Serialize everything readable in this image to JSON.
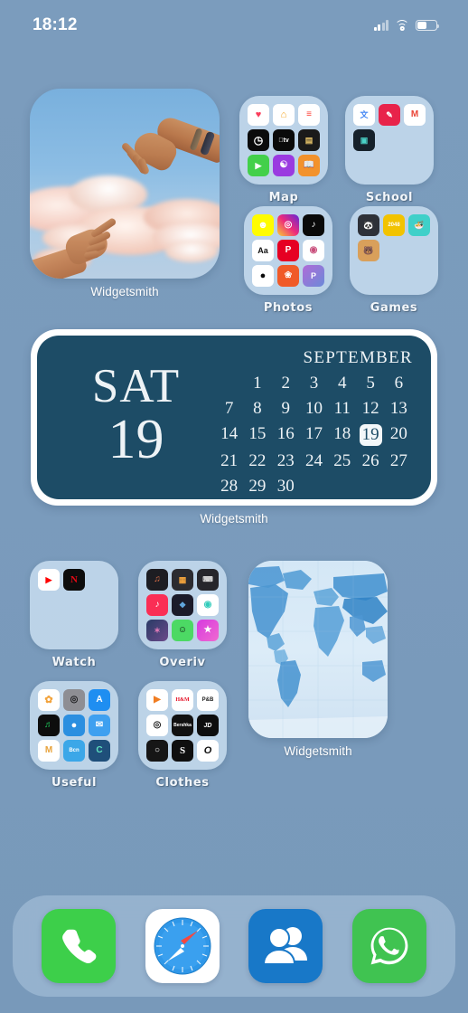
{
  "status_bar": {
    "time": "18:12",
    "signal_icon": "cellular-bars-icon",
    "wifi_icon": "wifi-icon",
    "battery_icon": "battery-icon",
    "battery_level_percent": 45
  },
  "wallpaper": {
    "background_color": "#799bbd"
  },
  "home_screen": {
    "rows": [
      {
        "row_index": 1,
        "items": [
          {
            "type": "widget",
            "name": "photo-widget",
            "label": "Widgetsmith",
            "size": "medium-square",
            "description": "two hands reaching toward each other over pink clouds in a blue sky"
          },
          {
            "type": "folder",
            "name": "folder-map",
            "label": "Map",
            "apps": [
              {
                "name": "health",
                "glyph": "♥",
                "bg": "#ffffff",
                "fg": "#fa3c5a"
              },
              {
                "name": "home",
                "glyph": "⌂",
                "bg": "#ffffff",
                "fg": "#f5a623"
              },
              {
                "name": "reminders",
                "glyph": "≡",
                "bg": "#ffffff",
                "fg": "#ff3b30"
              },
              {
                "name": "clock",
                "glyph": "◴",
                "bg": "#0b0b0b",
                "fg": "#ffffff"
              },
              {
                "name": "apple-tv",
                "glyph": "tv",
                "bg": "#0a0a0a",
                "fg": "#ffffff"
              },
              {
                "name": "wallet",
                "glyph": "▤",
                "bg": "#1a1a1a",
                "fg": "#e8c56a"
              },
              {
                "name": "facetime",
                "glyph": "▶",
                "bg": "#43d04a",
                "fg": "#ffffff"
              },
              {
                "name": "podcasts",
                "glyph": "✿",
                "bg": "#9a3ae0",
                "fg": "#ffffff"
              },
              {
                "name": "books",
                "glyph": "□",
                "bg": "#f2922c",
                "fg": "#ffffff"
              }
            ]
          },
          {
            "type": "folder",
            "name": "folder-school",
            "label": "School",
            "apps": [
              {
                "name": "google-translate",
                "glyph": "文",
                "bg": "#ffffff",
                "fg": "#4285f4"
              },
              {
                "name": "classroom",
                "glyph": "✎",
                "bg": "#e8234a",
                "fg": "#ffffff"
              },
              {
                "name": "gmail",
                "glyph": "M",
                "bg": "#ffffff",
                "fg": "#ea4335"
              },
              {
                "name": "teams",
                "glyph": "▣",
                "bg": "#16212b",
                "fg": "#4ad3c8"
              }
            ]
          }
        ]
      },
      {
        "row_index": 2,
        "items": [
          {
            "type": "folder",
            "name": "folder-photos",
            "label": "Photos",
            "apps": [
              {
                "name": "snapchat",
                "glyph": "●",
                "bg": "#fffc00",
                "fg": "#ffffff"
              },
              {
                "name": "instagram",
                "glyph": "◎",
                "bg": "#c13584",
                "fg": "#ffffff"
              },
              {
                "name": "tiktok",
                "glyph": "♪",
                "bg": "#0a0a0a",
                "fg": "#ffffff"
              },
              {
                "name": "fonts-app",
                "glyph": "Aa",
                "bg": "#ffffff",
                "fg": "#111111"
              },
              {
                "name": "pinterest",
                "glyph": "P",
                "bg": "#e60023",
                "fg": "#ffffff"
              },
              {
                "name": "vsco",
                "glyph": "◉",
                "bg": "#ffffff",
                "fg": "#c94f7c"
              },
              {
                "name": "lightroom",
                "glyph": "●",
                "bg": "#ffffff",
                "fg": "#0a0a0a"
              },
              {
                "name": "picsart",
                "glyph": "❀",
                "bg": "#f05a28",
                "fg": "#ffffff"
              },
              {
                "name": "prequel",
                "glyph": "P",
                "bg": "#b06bd8",
                "fg": "#ffffff"
              }
            ]
          },
          {
            "type": "folder",
            "name": "folder-games",
            "label": "Games",
            "apps": [
              {
                "name": "panda-game",
                "glyph": "●",
                "bg": "#2e3138",
                "fg": "#ffffff"
              },
              {
                "name": "2048-game",
                "glyph": "2048",
                "bg": "#f2c300",
                "fg": "#ffffff"
              },
              {
                "name": "cooking-game",
                "glyph": "●",
                "bg": "#3fd0c9",
                "fg": "#ffffff"
              },
              {
                "name": "bear-game",
                "glyph": "●",
                "bg": "#d9a05b",
                "fg": "#ffffff"
              }
            ]
          }
        ]
      },
      {
        "row_index": 3,
        "items": [
          {
            "type": "widget",
            "name": "calendar-widget",
            "label": "Widgetsmith",
            "size": "large-wide"
          }
        ]
      },
      {
        "row_index": 4,
        "items": [
          {
            "type": "folder",
            "name": "folder-watch",
            "label": "Watch",
            "apps": [
              {
                "name": "youtube",
                "glyph": "▶",
                "bg": "#ffffff",
                "fg": "#ff0000"
              },
              {
                "name": "netflix",
                "glyph": "N",
                "bg": "#0d0d0d",
                "fg": "#e50914"
              }
            ]
          },
          {
            "type": "folder",
            "name": "folder-overiv",
            "label": "Overiv",
            "apps": [
              {
                "name": "garageband",
                "glyph": "♫",
                "bg": "#1d1d22",
                "fg": "#e8734a"
              },
              {
                "name": "calculator",
                "glyph": "▦",
                "bg": "#2b2b30",
                "fg": "#f2a33c"
              },
              {
                "name": "keyboard-app",
                "glyph": "⌨",
                "bg": "#26262b",
                "fg": "#d8d8d8"
              },
              {
                "name": "apple-music",
                "glyph": "♪",
                "bg": "#fa2e55",
                "fg": "#ffffff"
              },
              {
                "name": "shortcuts",
                "glyph": "❖",
                "bg": "#1b1b2a",
                "fg": "#62a8e0"
              },
              {
                "name": "waze",
                "glyph": "◉",
                "bg": "#ffffff",
                "fg": "#33ccbb"
              },
              {
                "name": "spark",
                "glyph": "✦",
                "bg": "#2a3b66",
                "fg": "#e07ab8"
              },
              {
                "name": "messenger-green",
                "glyph": "☺",
                "bg": "#4cd964",
                "fg": "#0a0a0a"
              },
              {
                "name": "imovie",
                "glyph": "★",
                "bg": "#d63ae0",
                "fg": "#ffffff"
              }
            ]
          },
          {
            "type": "widget",
            "name": "world-map-widget",
            "label": "Widgetsmith",
            "size": "tall",
            "description": "blue political world map"
          }
        ]
      },
      {
        "row_index": 5,
        "items": [
          {
            "type": "folder",
            "name": "folder-useful",
            "label": "Useful",
            "apps": [
              {
                "name": "photos",
                "glyph": "✿",
                "bg": "#ffffff",
                "fg": "#f2a33c"
              },
              {
                "name": "camera",
                "glyph": "◎",
                "bg": "#8e8e93",
                "fg": "#1c1c1e"
              },
              {
                "name": "app-store",
                "glyph": "A",
                "bg": "#1f8ef1",
                "fg": "#ffffff"
              },
              {
                "name": "spotify",
                "glyph": "♬",
                "bg": "#0d0d0d",
                "fg": "#1db954"
              },
              {
                "name": "safari-alt",
                "glyph": "●",
                "bg": "#2b8fe0",
                "fg": "#ffffff"
              },
              {
                "name": "mail",
                "glyph": "✉",
                "bg": "#3ea0f0",
                "fg": "#ffffff"
              },
              {
                "name": "mcdonalds",
                "glyph": "M",
                "bg": "#ffffff",
                "fg": "#e8a33c"
              },
              {
                "name": "bcn-transit",
                "glyph": "Bcn",
                "bg": "#3ba7e8",
                "fg": "#ffffff"
              },
              {
                "name": "calendar-app",
                "glyph": "C",
                "bg": "#1f4f7a",
                "fg": "#5fe0c0"
              }
            ]
          },
          {
            "type": "folder",
            "name": "folder-clothes",
            "label": "Clothes",
            "apps": [
              {
                "name": "shein",
                "glyph": "▶",
                "bg": "#ffffff",
                "fg": "#f07d22"
              },
              {
                "name": "hm",
                "glyph": "H&M",
                "bg": "#ffffff",
                "fg": "#e50f24"
              },
              {
                "name": "pull-and-bear",
                "glyph": "P&B",
                "bg": "#ffffff",
                "fg": "#1a1a1a"
              },
              {
                "name": "zara",
                "glyph": "◎",
                "bg": "#ffffff",
                "fg": "#1a1a1a"
              },
              {
                "name": "bershka",
                "glyph": "B",
                "bg": "#111111",
                "fg": "#ffffff"
              },
              {
                "name": "jd-sports",
                "glyph": "JD",
                "bg": "#0d0d0d",
                "fg": "#ffffff"
              },
              {
                "name": "stradivarius",
                "glyph": "○",
                "bg": "#161616",
                "fg": "#ffffff"
              },
              {
                "name": "sfera",
                "glyph": "S",
                "bg": "#0f0f0f",
                "fg": "#ffffff"
              },
              {
                "name": "oysho",
                "glyph": "O",
                "bg": "#ffffff",
                "fg": "#111111"
              }
            ]
          },
          {
            "type": "widget-continued",
            "name": "world-map-widget-label",
            "label": "Widgetsmith"
          }
        ]
      }
    ]
  },
  "calendar_widget": {
    "weekday": "SAT",
    "day": "19",
    "month": "SEPTEMBER",
    "highlight_day": 19,
    "background_color": "#1d4c66",
    "border_color": "#ffffff",
    "text_color": "#eef3f6",
    "days": [
      "",
      "1",
      "2",
      "3",
      "4",
      "5",
      "6",
      "7",
      "8",
      "9",
      "10",
      "11",
      "12",
      "13",
      "14",
      "15",
      "16",
      "17",
      "18",
      "19",
      "20",
      "21",
      "22",
      "23",
      "24",
      "25",
      "26",
      "27",
      "28",
      "29",
      "30",
      "",
      "",
      "",
      ""
    ],
    "label": "Widgetsmith"
  },
  "dock": {
    "apps": [
      {
        "name": "phone",
        "label": "Phone",
        "bg": "#3dcf4a",
        "icon": "phone-icon"
      },
      {
        "name": "safari",
        "label": "Safari",
        "bg": "#ffffff",
        "icon": "compass-icon"
      },
      {
        "name": "contacts",
        "label": "Contacts",
        "bg": "#1878c8",
        "icon": "people-icon"
      },
      {
        "name": "whatsapp",
        "label": "WhatsApp",
        "bg": "#40c351",
        "icon": "whatsapp-icon"
      }
    ]
  }
}
